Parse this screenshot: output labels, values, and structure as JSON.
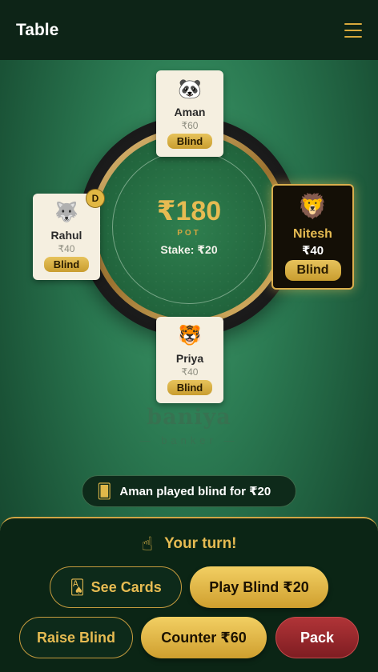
{
  "header": {
    "title": "Table",
    "menu_icon": "hamburger-menu-icon"
  },
  "table": {
    "pot_amount": "₹180",
    "pot_label": "POT",
    "stake": "Stake: ₹20"
  },
  "players": {
    "aman": {
      "avatar": "🐼",
      "name": "Aman",
      "amount": "₹60",
      "status": "Blind"
    },
    "rahul": {
      "avatar": "🐺",
      "name": "Rahul",
      "amount": "₹40",
      "status": "Blind",
      "dealer": "D"
    },
    "priya": {
      "avatar": "🐯",
      "name": "Priya",
      "amount": "₹40",
      "status": "Blind"
    },
    "nitesh": {
      "avatar": "🦁",
      "name": "Nitesh",
      "amount": "₹40",
      "status": "Blind",
      "active": true
    }
  },
  "brand": {
    "name": "baniya",
    "tagline": "— banker —"
  },
  "activity": {
    "icon": "dice-icon",
    "text": "Aman played blind for ₹20"
  },
  "turn": {
    "icon": "pointing-hand-icon",
    "text": "Your turn!"
  },
  "actions": {
    "see_cards": "See Cards",
    "play_blind": "Play Blind ₹20",
    "raise_blind": "Raise Blind",
    "counter": "Counter ₹60",
    "pack": "Pack"
  },
  "colors": {
    "accent": "#e6bb52",
    "felt": "#2b7a52",
    "danger": "#9a2a2e"
  }
}
